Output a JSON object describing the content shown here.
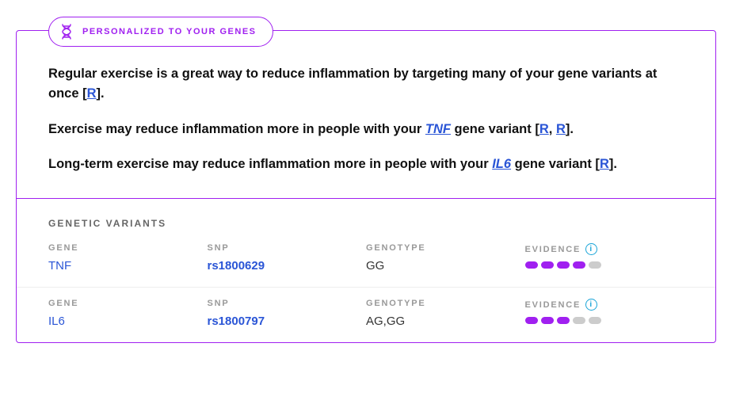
{
  "badge": {
    "label": "PERSONALIZED TO YOUR GENES"
  },
  "paragraphs": {
    "p1_a": "Regular exercise is a great way to reduce inflammation by targeting many of your gene variants at once [",
    "p1_r1": "R",
    "p1_b": "].",
    "p2_a": "Exercise may reduce inflammation more in people with your ",
    "p2_gene": "TNF",
    "p2_b": " gene variant [",
    "p2_r1": "R",
    "p2_c": ", ",
    "p2_r2": "R",
    "p2_d": "].",
    "p3_a": "Long-term exercise may reduce inflammation more in people with your ",
    "p3_gene": "IL6",
    "p3_b": " gene variant [",
    "p3_r1": "R",
    "p3_c": "]."
  },
  "variants": {
    "title": "GENETIC VARIANTS",
    "labels": {
      "gene": "GENE",
      "snp": "SNP",
      "genotype": "GENOTYPE",
      "evidence": "EVIDENCE"
    },
    "rows": [
      {
        "gene": "TNF",
        "snp": "rs1800629",
        "genotype": "GG",
        "evidence": 4,
        "max": 5
      },
      {
        "gene": "IL6",
        "snp": "rs1800797",
        "genotype": "AG,GG",
        "evidence": 3,
        "max": 5
      }
    ]
  },
  "chart_data": [
    {
      "type": "bar",
      "title": "Evidence TNF rs1800629",
      "categories": [
        "evidence"
      ],
      "values": [
        4
      ],
      "ylim": [
        0,
        5
      ]
    },
    {
      "type": "bar",
      "title": "Evidence IL6 rs1800797",
      "categories": [
        "evidence"
      ],
      "values": [
        3
      ],
      "ylim": [
        0,
        5
      ]
    }
  ]
}
